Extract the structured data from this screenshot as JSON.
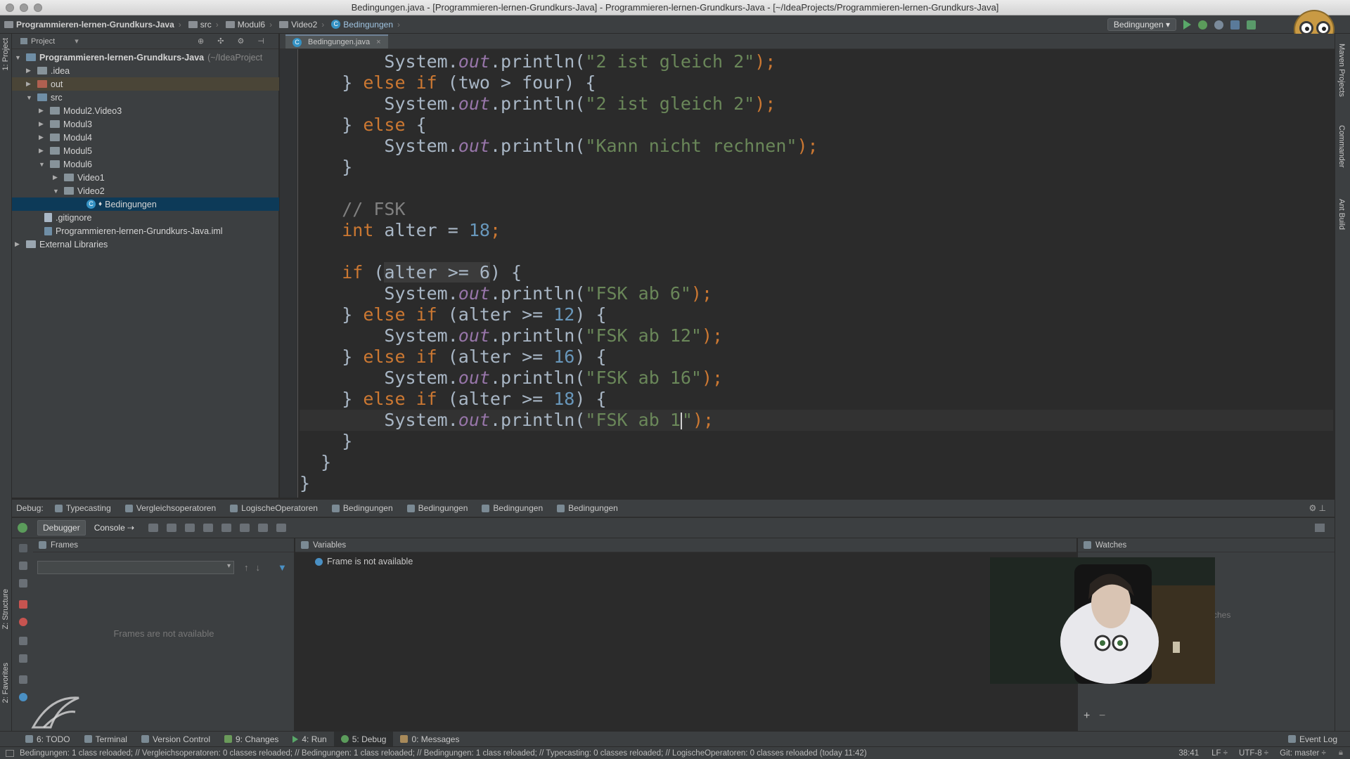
{
  "window": {
    "title": "Bedingungen.java - [Programmieren-lernen-Grundkurs-Java] - Programmieren-lernen-Grundkurs-Java - [~/IdeaProjects/Programmieren-lernen-Grundkurs-Java]"
  },
  "navbar": {
    "crumbs": [
      "Programmieren-lernen-Grundkurs-Java",
      "src",
      "Modul6",
      "Video2",
      "Bedingungen"
    ],
    "run_config": "Bedingungen"
  },
  "left_tools": {
    "project": "1: Project",
    "structure": "Z: Structure",
    "favorites": "2: Favorites"
  },
  "right_tools": {
    "maven": "Maven Projects",
    "commander": "Commander",
    "ant": "Ant Build"
  },
  "project": {
    "header": "Project",
    "root": "Programmieren-lernen-Grundkurs-Java",
    "root_path": "(~/IdeaProject",
    "idea": ".idea",
    "out": "out",
    "src": "src",
    "modul2": "Modul2.Video3",
    "modul3": "Modul3",
    "modul4": "Modul4",
    "modul5": "Modul5",
    "modul6": "Modul6",
    "video1": "Video1",
    "video2": "Video2",
    "bedingungen": "Bedingungen",
    "gitignore": ".gitignore",
    "iml": "Programmieren-lernen-Grundkurs-Java.iml",
    "ext": "External Libraries"
  },
  "editor": {
    "tab": "Bedingungen.java",
    "lines": {
      "l1a": "        System.",
      "l1b": "out",
      "l1c": ".println(",
      "l1d": "\"2 ist gleich 2\"",
      "l1e": ");",
      "l2": "    } ",
      "l2kw": "else if",
      "l2b": " (two > four) {",
      "l3a": "        System.",
      "l3b": "out",
      "l3c": ".println(",
      "l3d": "\"2 ist gleich 2\"",
      "l3e": ");",
      "l4": "    } ",
      "l4kw": "else",
      "l4b": " {",
      "l5a": "        System.",
      "l5b": "out",
      "l5c": ".println(",
      "l5d": "\"Kann nicht rechnen\"",
      "l5e": ");",
      "l6": "    }",
      "l8": "    // FSK",
      "l9a": "    ",
      "l9kw": "int",
      "l9b": " alter = ",
      "l9n": "18",
      "l9c": ";",
      "l11a": "    ",
      "l11kw": "if",
      "l11b": " (",
      "l11h": "alter >= 6",
      "l11c": ") {",
      "l12a": "        System.",
      "l12b": "out",
      "l12c": ".println(",
      "l12d": "\"FSK ab 6\"",
      "l12e": ");",
      "l13": "    } ",
      "l13kw": "else if",
      "l13b": " (alter >= ",
      "l13n": "12",
      "l13c": ") {",
      "l14a": "        System.",
      "l14b": "out",
      "l14c": ".println(",
      "l14d": "\"FSK ab 12\"",
      "l14e": ");",
      "l15": "    } ",
      "l15kw": "else if",
      "l15b": " (alter >= ",
      "l15n": "16",
      "l15c": ") {",
      "l16a": "        System.",
      "l16b": "out",
      "l16c": ".println(",
      "l16d": "\"FSK ab 16\"",
      "l16e": ");",
      "l17": "    } ",
      "l17kw": "else if",
      "l17b": " (alter >= ",
      "l17n": "18",
      "l17c": ") {",
      "l18a": "        System.",
      "l18b": "out",
      "l18c": ".println(",
      "l18d": "\"FSK ab 1",
      "l18d2": "\"",
      "l18e": ");",
      "l19": "    }",
      "l20": "  }",
      "l21": "}"
    }
  },
  "debug": {
    "label": "Debug:",
    "tabs": [
      "Typecasting",
      "Vergleichsoperatoren",
      "LogischeOperatoren",
      "Bedingungen",
      "Bedingungen",
      "Bedingungen",
      "Bedingungen"
    ],
    "debugger": "Debugger",
    "console": "Console",
    "frames": "Frames",
    "frames_empty": "Frames are not available",
    "variables": "Variables",
    "frame_na": "Frame is not available",
    "watches": "Watches",
    "watches_partial": "ches"
  },
  "bottom_tabs": {
    "todo": "6: TODO",
    "terminal": "Terminal",
    "vcs": "Version Control",
    "changes": "9: Changes",
    "run": "4: Run",
    "debug": "5: Debug",
    "messages": "0: Messages",
    "eventlog": "Event Log"
  },
  "status": {
    "message": "Bedingungen: 1 class reloaded; // Vergleichsoperatoren: 0 classes reloaded; // Bedingungen: 1 class reloaded; // Bedingungen: 1 class reloaded; // Typecasting: 0 classes reloaded; // LogischeOperatoren: 0 classes reloaded (today 11:42)",
    "position": "38:41",
    "lf": "LF ÷",
    "encoding": "UTF-8 ÷",
    "git": "Git: master ÷"
  },
  "colors": {
    "keyword": "#cc7832",
    "string": "#6a8759",
    "number": "#6897bb",
    "field": "#9876aa",
    "selection": "#0d3a58"
  }
}
